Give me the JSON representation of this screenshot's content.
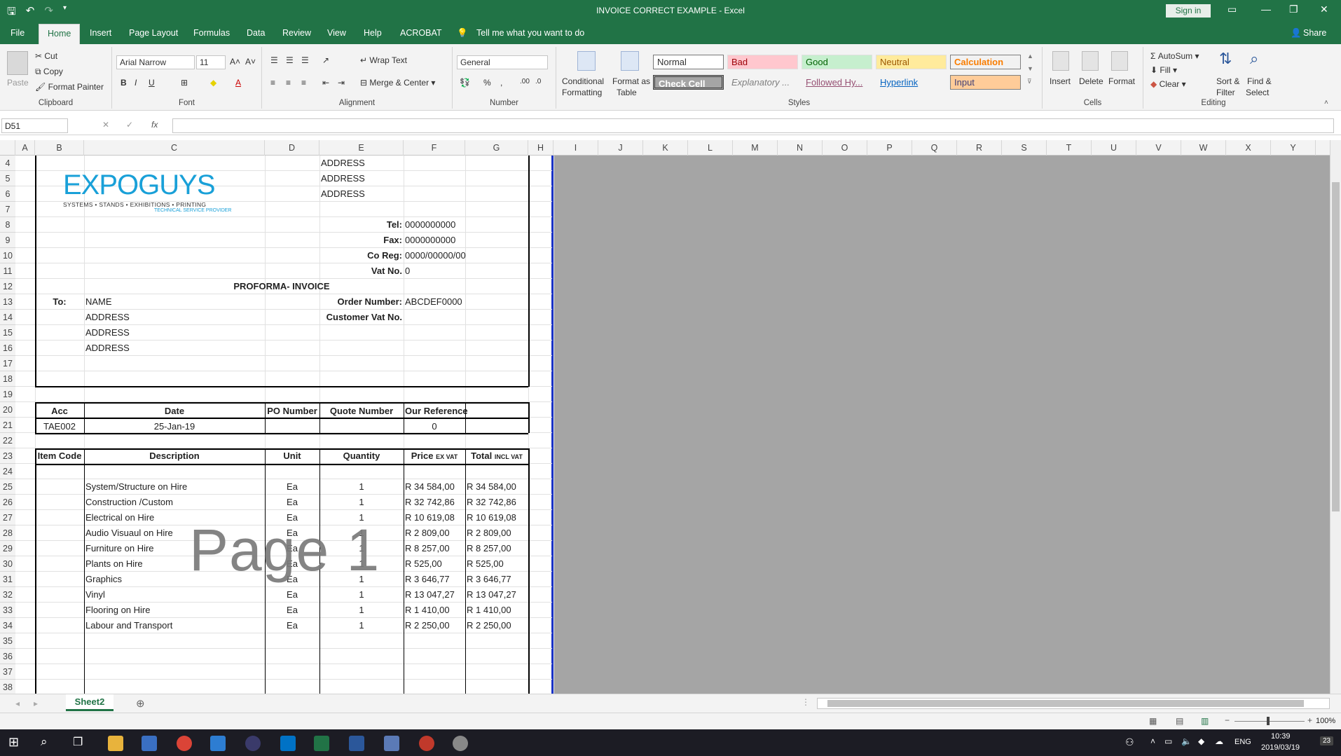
{
  "window": {
    "title": "INVOICE CORRECT EXAMPLE  -  Excel",
    "signin": "Sign in"
  },
  "tabs": [
    "File",
    "Home",
    "Insert",
    "Page Layout",
    "Formulas",
    "Data",
    "Review",
    "View",
    "Help",
    "ACROBAT"
  ],
  "tell_me": "Tell me what you want to do",
  "share": "Share",
  "clipboard": {
    "paste": "Paste",
    "cut": "Cut",
    "copy": "Copy",
    "format_painter": "Format Painter",
    "label": "Clipboard"
  },
  "font": {
    "name": "Arial Narrow",
    "size": "11",
    "label": "Font"
  },
  "alignment": {
    "wrap": "Wrap Text",
    "merge": "Merge & Center",
    "label": "Alignment"
  },
  "number": {
    "format": "General",
    "label": "Number"
  },
  "styles": {
    "conditional": "Conditional",
    "formatting": "Formatting",
    "format_as": "Format as",
    "table": "Table",
    "normal": "Normal",
    "bad": "Bad",
    "good": "Good",
    "neutral": "Neutral",
    "calculation": "Calculation",
    "check": "Check Cell",
    "explanatory": "Explanatory ...",
    "followed": "Followed Hy...",
    "hyperlink": "Hyperlink",
    "input": "Input",
    "label": "Styles"
  },
  "cells": {
    "insert": "Insert",
    "delete": "Delete",
    "format": "Format",
    "label": "Cells"
  },
  "editing": {
    "autosum": "AutoSum",
    "fill": "Fill",
    "clear": "Clear",
    "sort": "Sort &",
    "filter": "Filter",
    "find": "Find &",
    "select": "Select",
    "label": "Editing"
  },
  "namebox": "D51",
  "columns": [
    "A",
    "B",
    "C",
    "D",
    "E",
    "F",
    "G",
    "H",
    "I",
    "J",
    "K",
    "L",
    "M",
    "N",
    "O",
    "P",
    "Q",
    "R",
    "S",
    "T",
    "U",
    "V",
    "W",
    "X",
    "Y"
  ],
  "rows": [
    "4",
    "5",
    "6",
    "7",
    "8",
    "9",
    "10",
    "11",
    "12",
    "13",
    "14",
    "15",
    "16",
    "17",
    "18",
    "19",
    "20",
    "21",
    "22",
    "23",
    "24",
    "25",
    "26",
    "27",
    "28",
    "29",
    "30",
    "31",
    "32",
    "33",
    "34",
    "35",
    "36",
    "37",
    "38"
  ],
  "logo": {
    "main": "EXPOGUYS",
    "tagline": "SYSTEMS • STANDS • EXHIBITIONS • PRINTING",
    "sub": "TECHNICAL SERVICE PROVIDER"
  },
  "company": {
    "addr1": "ADDRESS",
    "addr2": "ADDRESS",
    "addr3": "ADDRESS",
    "tel_label": "Tel:",
    "tel": "0000000000",
    "fax_label": "Fax:",
    "fax": "0000000000",
    "coreg_label": "Co Reg:",
    "coreg": "0000/00000/00",
    "vat_label": "Vat No.",
    "vat": "0"
  },
  "invoice_title": "PROFORMA- INVOICE",
  "to": {
    "label": "To:",
    "name": "NAME",
    "addr1": "ADDRESS",
    "addr2": "ADDRESS",
    "addr3": "ADDRESS",
    "order_label": "Order Number:",
    "order": "ABCDEF0000",
    "custvat_label": "Customer Vat No."
  },
  "ref_headers": {
    "acc": "Acc",
    "date": "Date",
    "po": "PO Number",
    "quote": "Quote Number",
    "ourref": "Our Reference"
  },
  "ref_values": {
    "acc": "TAE002",
    "date": "25-Jan-19",
    "ourref": "0"
  },
  "item_headers": {
    "code": "Item Code",
    "desc": "Description",
    "unit": "Unit",
    "qty": "Quantity",
    "price": "Price",
    "price_sub": "EX VAT",
    "total": "Total",
    "total_sub": "INCL VAT"
  },
  "items": [
    {
      "desc": "System/Structure on Hire",
      "unit": "Ea",
      "qty": "1",
      "price": "R 34 584,00",
      "total": "R 34 584,00"
    },
    {
      "desc": "Construction /Custom",
      "unit": "Ea",
      "qty": "1",
      "price": "R 32 742,86",
      "total": "R 32 742,86"
    },
    {
      "desc": "Electrical on Hire",
      "unit": "Ea",
      "qty": "1",
      "price": "R 10 619,08",
      "total": "R 10 619,08"
    },
    {
      "desc": "Audio Visuaul on Hire",
      "unit": "Ea",
      "qty": "1",
      "price": "R 2 809,00",
      "total": "R 2 809,00"
    },
    {
      "desc": "Furniture on Hire",
      "unit": "Ea",
      "qty": "1",
      "price": "R 8 257,00",
      "total": "R 8 257,00"
    },
    {
      "desc": "Plants on Hire",
      "unit": "Ea",
      "qty": "1",
      "price": "R 525,00",
      "total": "R 525,00"
    },
    {
      "desc": "Graphics",
      "unit": "Ea",
      "qty": "1",
      "price": "R 3 646,77",
      "total": "R 3 646,77"
    },
    {
      "desc": "Vinyl",
      "unit": "Ea",
      "qty": "1",
      "price": "R 13 047,27",
      "total": "R 13 047,27"
    },
    {
      "desc": "Flooring on Hire",
      "unit": "Ea",
      "qty": "1",
      "price": "R 1 410,00",
      "total": "R 1 410,00"
    },
    {
      "desc": "Labour and Transport",
      "unit": "Ea",
      "qty": "1",
      "price": "R 2 250,00",
      "total": "R 2 250,00"
    }
  ],
  "watermark": "Page 1",
  "sheet_tab": "Sheet2",
  "zoom": "100%",
  "taskbar": {
    "lang": "ENG",
    "time": "10:39",
    "date": "2019/03/19",
    "badge": "23"
  }
}
